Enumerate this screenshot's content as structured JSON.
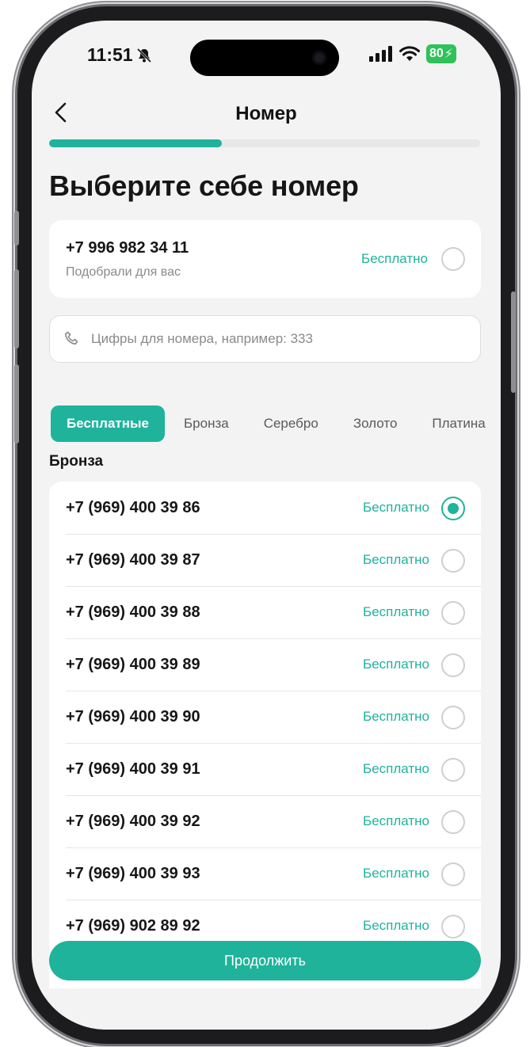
{
  "status_bar": {
    "time": "11:51",
    "battery": "80",
    "icons": [
      "bell-mute-icon",
      "signal-icon",
      "wifi-icon",
      "battery-icon"
    ]
  },
  "header": {
    "title": "Номер",
    "progress_fraction": 0.4
  },
  "heading": "Выберите себе номер",
  "suggested": {
    "number": "+7 996 982 34 11",
    "subtitle": "Подобрали для вас",
    "price": "Бесплатно"
  },
  "search": {
    "placeholder": "Цифры для номера, например: 333"
  },
  "tabs": [
    {
      "label": "Бесплатные",
      "active": true
    },
    {
      "label": "Бронза",
      "active": false
    },
    {
      "label": "Серебро",
      "active": false
    },
    {
      "label": "Золото",
      "active": false
    },
    {
      "label": "Платина",
      "active": false
    }
  ],
  "section_label": "Бронза",
  "numbers": [
    {
      "number": "+7 (969) 400 39 86",
      "price": "Бесплатно",
      "selected": true
    },
    {
      "number": "+7 (969) 400 39 87",
      "price": "Бесплатно",
      "selected": false
    },
    {
      "number": "+7 (969) 400 39 88",
      "price": "Бесплатно",
      "selected": false
    },
    {
      "number": "+7 (969) 400 39 89",
      "price": "Бесплатно",
      "selected": false
    },
    {
      "number": "+7 (969) 400 39 90",
      "price": "Бесплатно",
      "selected": false
    },
    {
      "number": "+7 (969) 400 39 91",
      "price": "Бесплатно",
      "selected": false
    },
    {
      "number": "+7 (969) 400 39 92",
      "price": "Бесплатно",
      "selected": false
    },
    {
      "number": "+7 (969) 400 39 93",
      "price": "Бесплатно",
      "selected": false
    },
    {
      "number": "+7 (969) 902 89 92",
      "price": "Бесплатно",
      "selected": false
    }
  ],
  "continue_button": "Продолжить",
  "colors": {
    "accent": "#1fb39b",
    "background": "#f3f3f3"
  }
}
